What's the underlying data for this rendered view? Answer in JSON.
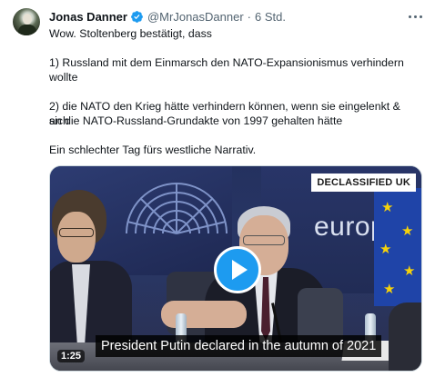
{
  "tweet": {
    "author_name": "Jonas Danner",
    "handle": "@MrJonasDanner",
    "separator": "·",
    "time": "6 Std.",
    "lines": [
      "Wow. Stoltenberg bestätigt, dass",
      "1) Russland mit dem Einmarsch den NATO-Expansionismus verhindern",
      "wollte",
      "2) die NATO den Krieg hätte verhindern können, wenn sie eingelenkt & sich",
      "an die NATO-Russland-Grundakte von 1997 gehalten hätte",
      "Ein schlechter Tag fürs westliche Narrativ."
    ]
  },
  "icons": {
    "verified": "verified-badge-icon",
    "more": "more-options-icon",
    "play": "play-icon"
  },
  "media": {
    "watermark": "DECLASSIFIED UK",
    "background_text": "europ",
    "subtitle": "President Putin declared in the autumn of 2021",
    "duration": "1:25"
  },
  "colors": {
    "accent": "#1d9bf0",
    "text_primary": "#0f1419",
    "text_secondary": "#536471"
  }
}
